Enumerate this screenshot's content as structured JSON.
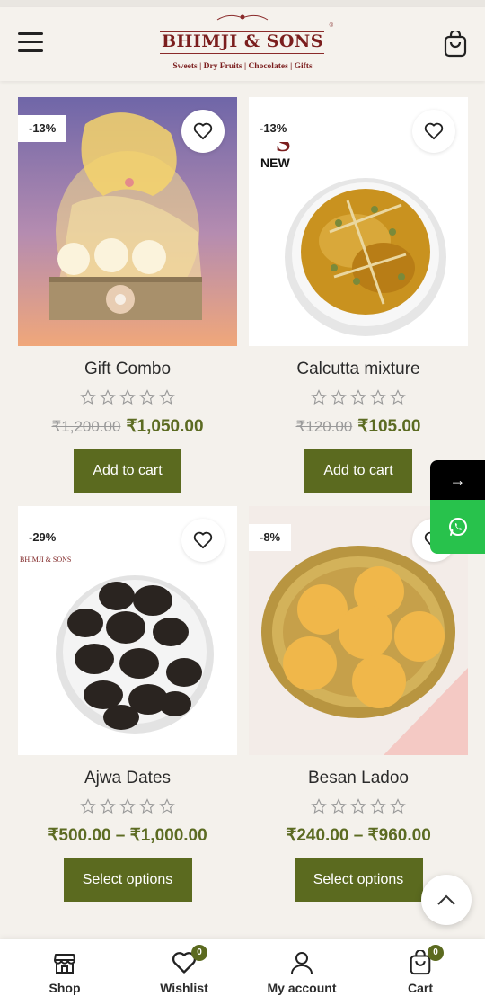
{
  "header": {
    "brand_name": "BHIMJI & SONS",
    "brand_reg": "®",
    "tagline": "Sweets | Dry Fruits | Chocolates | Gifts"
  },
  "products": [
    {
      "title": "Gift Combo",
      "badge": "-13%",
      "new_badge": "",
      "old_price": "₹1,200.00",
      "price": "₹1,050.00",
      "cta": "Add to cart",
      "rating": 0
    },
    {
      "title": "Calcutta mixture",
      "badge": "-13%",
      "new_badge": "NEW",
      "old_price": "₹120.00",
      "price": "₹105.00",
      "cta": "Add to cart",
      "rating": 0
    },
    {
      "title": "Ajwa Dates",
      "badge": "-29%",
      "new_badge": "",
      "old_price": "",
      "price": "₹500.00 – ₹1,000.00",
      "cta": "Select options",
      "rating": 0
    },
    {
      "title": "Besan Ladoo",
      "badge": "-8%",
      "new_badge": "",
      "old_price": "",
      "price": "₹240.00 – ₹960.00",
      "cta": "Select options",
      "rating": 0
    }
  ],
  "side": {
    "arrow": "→"
  },
  "bottom_nav": [
    {
      "label": "Shop",
      "icon": "shop-icon",
      "count": ""
    },
    {
      "label": "Wishlist",
      "icon": "heart-icon",
      "count": "0"
    },
    {
      "label": "My account",
      "icon": "user-icon",
      "count": ""
    },
    {
      "label": "Cart",
      "icon": "cart-icon",
      "count": "0"
    }
  ],
  "colors": {
    "accent": "#5b6a1f",
    "brand": "#7b1e1e",
    "whatsapp": "#28c24c",
    "background": "#f4f1ec"
  }
}
